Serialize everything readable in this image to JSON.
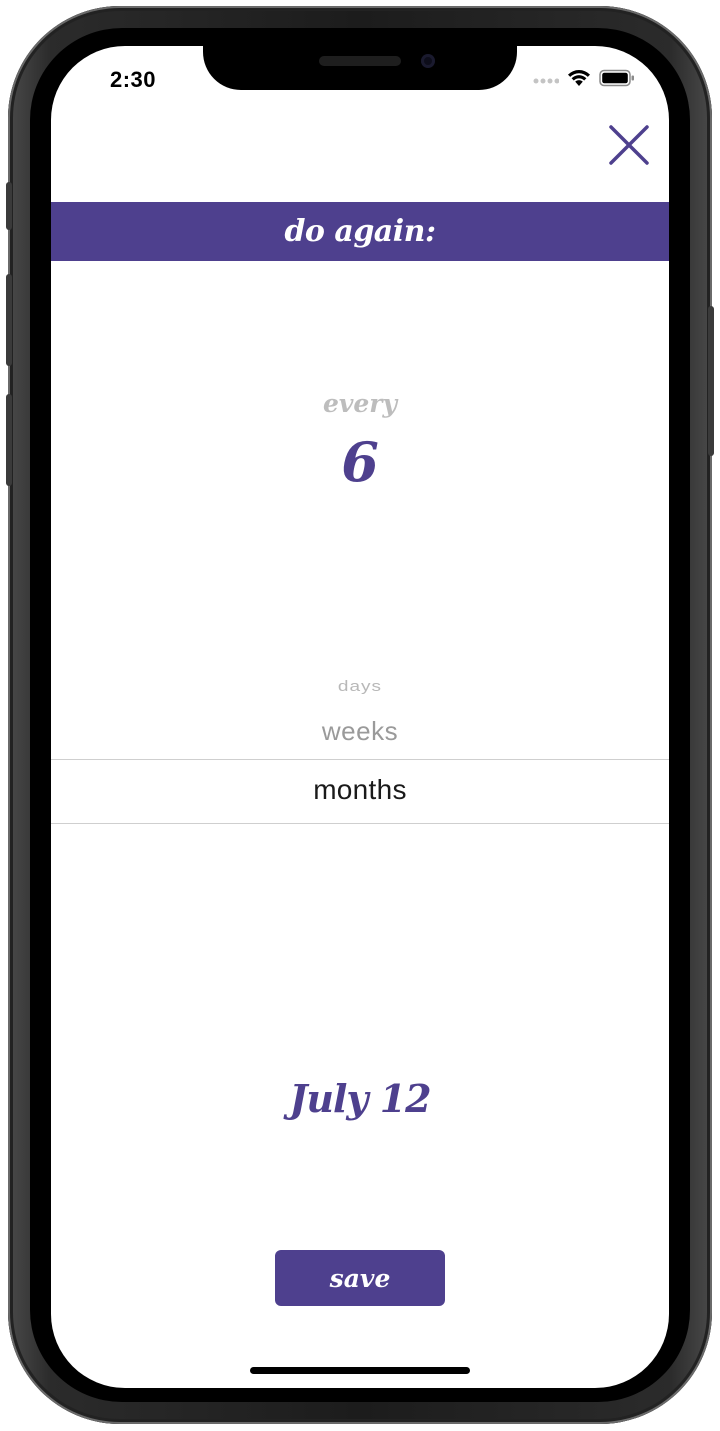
{
  "status_bar": {
    "time": "2:30",
    "signal_icon": "cellular-signal-icon",
    "wifi_icon": "wifi-icon",
    "battery_icon": "battery-icon"
  },
  "close_icon": "close-icon",
  "header": {
    "title": "do again:"
  },
  "interval": {
    "label": "every",
    "value": "6"
  },
  "unit_picker": {
    "items": [
      "days",
      "weeks",
      "months"
    ],
    "selected": "months"
  },
  "next_date": "July 12",
  "save_button": {
    "label": "save"
  },
  "colors": {
    "accent": "#4e408e",
    "muted_text": "#bdbdbd",
    "background": "#ffffff"
  }
}
